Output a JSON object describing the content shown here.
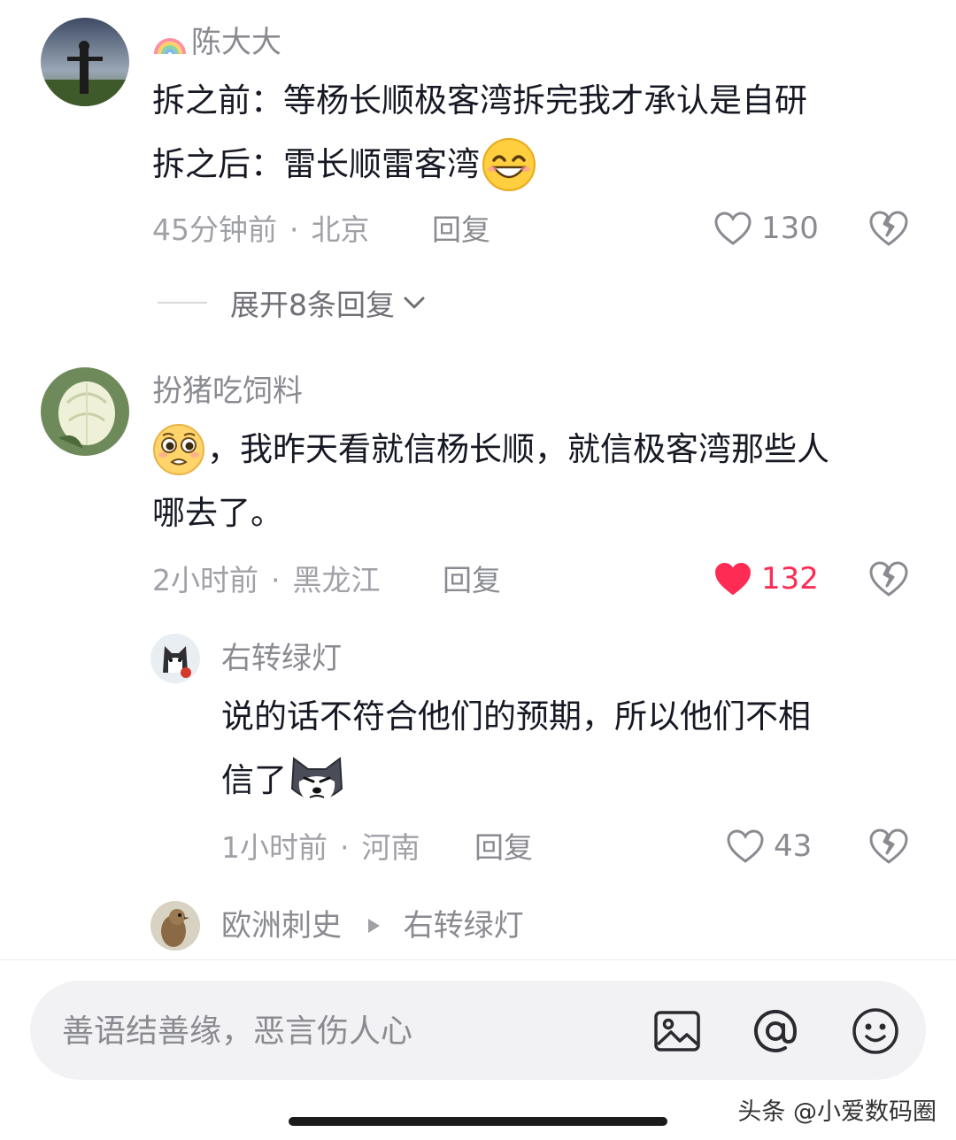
{
  "comments": [
    {
      "username": "陈大大",
      "text_lines": [
        "拆之前：等杨长顺极客湾拆完我才承认是自研",
        "拆之后：雷长顺雷客湾"
      ],
      "emoji": "grin-emoji",
      "time": "45分钟前",
      "location": "北京",
      "reply_label": "回复",
      "likes": "130",
      "liked": false,
      "expand_label": "展开8条回复"
    },
    {
      "username": "扮猪吃饲料",
      "text_lines": [
        "，我昨天看就信杨长顺，就信极客湾那些人",
        "哪去了。"
      ],
      "emoji": "pleading-emoji",
      "time": "2小时前",
      "location": "黑龙江",
      "reply_label": "回复",
      "likes": "132",
      "liked": true,
      "replies": [
        {
          "username": "右转绿灯",
          "text_lines": [
            "说的话不符合他们的预期，所以他们不相",
            "信了"
          ],
          "emoji": "husky-emoji",
          "time": "1小时前",
          "location": "河南",
          "reply_label": "回复",
          "likes": "43",
          "liked": false
        },
        {
          "username": "欧洲刺史",
          "reply_to": "右转绿灯"
        }
      ]
    }
  ],
  "input": {
    "placeholder": "善语结善缘，恶言伤人心"
  },
  "bar_icons": [
    "image-icon",
    "at-icon",
    "emoji-icon"
  ],
  "watermark": "头条 @小爱数码圈",
  "colors": {
    "accent_like": "#fe2c55",
    "meta_gray": "#a0a1a7",
    "text": "#161823"
  }
}
